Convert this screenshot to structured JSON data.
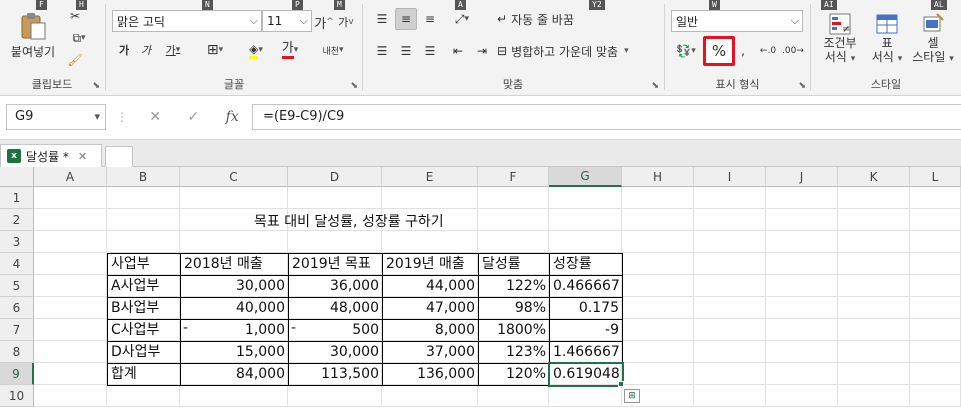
{
  "keytips": {
    "a": "F",
    "b": "H",
    "c": "N",
    "d": "P",
    "e": "M",
    "f": "A",
    "g": "W",
    "h": "Y2",
    "i": "AI",
    "j": "AL"
  },
  "clipboard": {
    "paste_label": "붙여넣기",
    "group_label": "클립보드"
  },
  "font": {
    "name": "맑은 고딕",
    "size": "11",
    "grow": "가",
    "shrink": "가",
    "bold": "가",
    "italic": "가",
    "underline": "가",
    "font_color_glyph": "가",
    "phonetic": "내천",
    "group_label": "글꼴"
  },
  "alignment": {
    "wrap_label": "자동 줄 바꿈",
    "merge_label": "병합하고 가운데 맞춤",
    "group_label": "맞춤"
  },
  "number": {
    "format": "일반",
    "percent_label": "%",
    "group_label": "표시 형식"
  },
  "styles": {
    "conditional_label": "조건부\n서식",
    "conditional_l1": "조건부",
    "conditional_l2": "서식",
    "table_l1": "표",
    "table_l2": "서식",
    "cell_l1": "셀",
    "cell_l2": "스타일",
    "group_label": "스타일"
  },
  "formula_bar": {
    "name_box": "G9",
    "fx": "fx",
    "formula": "=(E9-C9)/C9"
  },
  "sheet_tab": {
    "name": "달성률 *"
  },
  "columns": [
    "A",
    "B",
    "C",
    "D",
    "E",
    "F",
    "G",
    "H",
    "I",
    "J",
    "K",
    "L"
  ],
  "rows": [
    "1",
    "2",
    "3",
    "4",
    "5",
    "6",
    "7",
    "8",
    "9",
    "10"
  ],
  "sheet": {
    "title": "목표 대비 달성률, 성장률 구하기",
    "headers": [
      "사업부",
      "2018년 매출",
      "2019년 목표",
      "2019년 매출",
      "달성률",
      "성장률"
    ],
    "data": [
      [
        "A사업부",
        "30,000",
        "36,000",
        "44,000",
        "122%",
        "0.466667"
      ],
      [
        "B사업부",
        "40,000",
        "48,000",
        "47,000",
        "98%",
        "0.175"
      ],
      [
        "C사업부",
        "1,000",
        "500",
        "8,000",
        "1800%",
        "-9"
      ],
      [
        "D사업부",
        "15,000",
        "30,000",
        "37,000",
        "123%",
        "1.466667"
      ],
      [
        "합계",
        "84,000",
        "113,500",
        "136,000",
        "120%",
        "0.619048"
      ]
    ],
    "dash": "-"
  },
  "colors": {
    "excel_green": "#217346",
    "highlight_red": "#e81123"
  }
}
